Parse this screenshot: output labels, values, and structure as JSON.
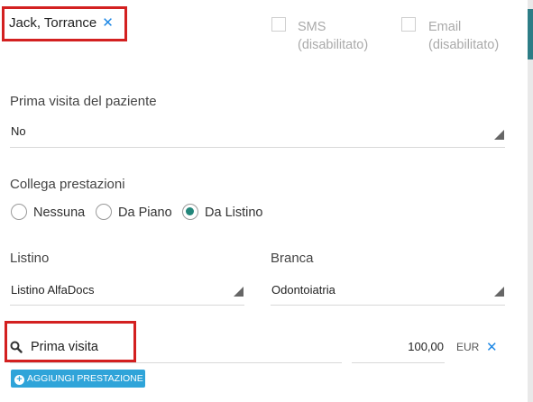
{
  "patient": {
    "name": "Jack, Torrance",
    "remove_icon": "close-icon"
  },
  "notifications": {
    "sms_label_1": "SMS",
    "sms_label_2": "(disabilitato)",
    "email_label_1": "Email",
    "email_label_2": "(disabilitato)"
  },
  "first_visit": {
    "label": "Prima visita del paziente",
    "value": "No"
  },
  "link_services": {
    "label": "Collega prestazioni",
    "options": [
      "Nessuna",
      "Da Piano",
      "Da Listino"
    ],
    "selected": "Da Listino"
  },
  "price_list": {
    "label": "Listino",
    "value": "Listino AlfaDocs"
  },
  "branch": {
    "label": "Branca",
    "value": "Odontoiatria"
  },
  "service_row": {
    "search_icon": "search-icon",
    "name": "Prima visita",
    "price": "100,00",
    "currency": "EUR",
    "remove_icon": "close-icon"
  },
  "add_button": {
    "label": "AGGIUNGI PRESTAZIONE",
    "icon": "plus-circle-icon"
  },
  "colors": {
    "highlight": "#d32020",
    "accent": "#1e88e5",
    "radio_selected": "#22867a",
    "button": "#2fa4d9"
  }
}
